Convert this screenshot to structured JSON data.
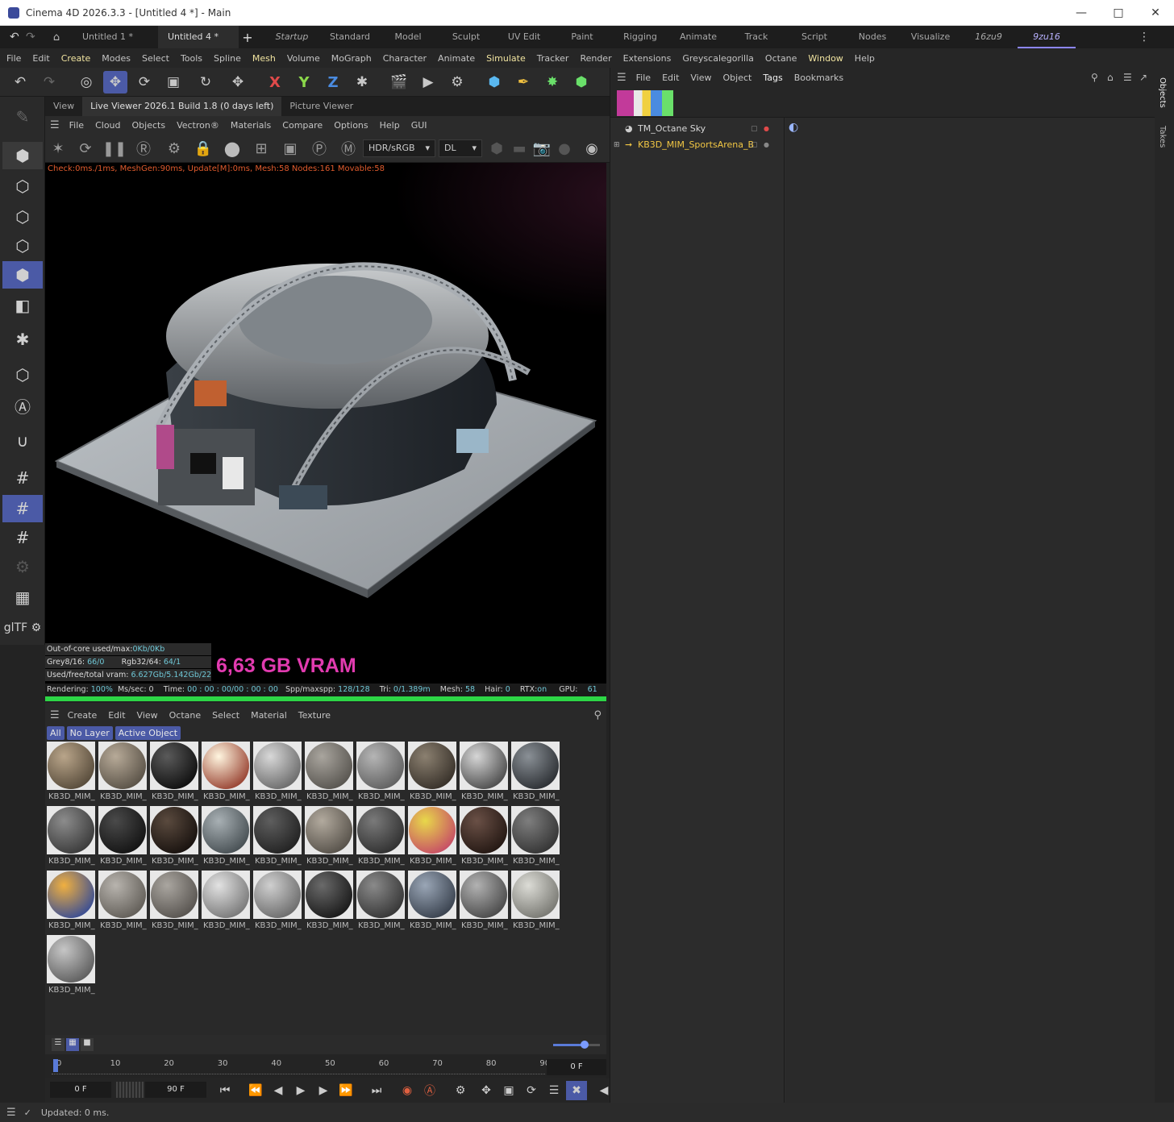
{
  "window": {
    "title": "Cinema 4D 2026.3.3 - [Untitled 4 *] - Main"
  },
  "doc_tabs": [
    {
      "label": "Untitled 1 *"
    },
    {
      "label": "Untitled 4 *"
    }
  ],
  "layouts": [
    "Startup",
    "Standard",
    "Model",
    "Sculpt",
    "UV Edit",
    "Paint",
    "Rigging",
    "Animate",
    "Track",
    "Script",
    "Nodes",
    "Visualize",
    "16zu9",
    "9zu16"
  ],
  "menubar": [
    "File",
    "Edit",
    "Create",
    "Modes",
    "Select",
    "Tools",
    "Spline",
    "Mesh",
    "Volume",
    "MoGraph",
    "Character",
    "Animate",
    "Simulate",
    "Tracker",
    "Render",
    "Extensions",
    "Greyscalegorilla",
    "Octane",
    "Window",
    "Help"
  ],
  "toolbar": {
    "axis": [
      "X",
      "Y",
      "Z"
    ],
    "colors": {
      "x": "#e04a4a",
      "y": "#8bd84a",
      "z": "#4a8be0",
      "accent": "#4b5aa6"
    }
  },
  "left_tools": {
    "gltf_label": "glTF"
  },
  "viewer_tabs": [
    "View",
    "Live Viewer 2026.1 Build 1.8 (0 days left)",
    "Picture Viewer"
  ],
  "lv_menu": [
    "File",
    "Cloud",
    "Objects",
    "Vectron®",
    "Materials",
    "Compare",
    "Options",
    "Help",
    "GUI"
  ],
  "lv_tools": {
    "colorspace": "HDR/sRGB",
    "kernel": "DL"
  },
  "viewport": {
    "stats_line": "Check:0ms./1ms, MeshGen:90ms, Update[M]:0ms, Mesh:58 Nodes:161 Movable:58",
    "vram_text": "6,63 GB VRAM",
    "info": {
      "outofcore_label": "Out-of-core used/max:",
      "outofcore_val": "0Kb/0Kb",
      "grey_label": "Grey8/16: ",
      "grey_val": "66/0",
      "rgb_label": "Rgb32/64: ",
      "rgb_val": "64/1",
      "vram_label": "Used/free/total vram: ",
      "vram_val": "6.627Gb/5.142Gb/22.488"
    }
  },
  "render_status": {
    "rendering_label": "Rendering: ",
    "rendering_val": "100%",
    "mssec": "Ms/sec: 0",
    "time_label": "Time: ",
    "time_val": "00 : 00 : 00/00 : 00 : 00",
    "spp_label": "Spp/maxspp: ",
    "spp_val": "128/128",
    "tri_label": "Tri: ",
    "tri_val": "0/1.389m",
    "mesh_label": "Mesh: ",
    "mesh_val": "58",
    "hair_label": "Hair: ",
    "hair_val": "0",
    "rtx_label": "RTX:",
    "rtx_val": "on",
    "gpu_label": "GPU:",
    "gpu_val": "61",
    "progress": 1.0
  },
  "mat_menu": [
    "Create",
    "Edit",
    "View",
    "Octane",
    "Select",
    "Material",
    "Texture"
  ],
  "mat_filters": [
    "All",
    "No Layer",
    "Active Object"
  ],
  "materials": [
    {
      "label": "KB3D_MIM_",
      "c1": "#b9a58a",
      "c2": "#4a3f30"
    },
    {
      "label": "KB3D_MIM_",
      "c1": "#b7aa98",
      "c2": "#4d463c"
    },
    {
      "label": "KB3D_MIM_",
      "c1": "#5a5a5a",
      "c2": "#050505"
    },
    {
      "label": "KB3D_MIM_",
      "c1": "#fff6e0",
      "c2": "#8a2a1a"
    },
    {
      "label": "KB3D_MIM_",
      "c1": "#d8d8d8",
      "c2": "#5c5c5c"
    },
    {
      "label": "KB3D_MIM_",
      "c1": "#a9a59e",
      "c2": "#4d4a45"
    },
    {
      "label": "KB3D_MIM_",
      "c1": "#b5b5b5",
      "c2": "#555555"
    },
    {
      "label": "KB3D_MIM_",
      "c1": "#8b8070",
      "c2": "#2c2620"
    },
    {
      "label": "KB3D_MIM_",
      "c1": "#d6d6d6",
      "c2": "#3a3a3a"
    },
    {
      "label": "KB3D_MIM_",
      "c1": "#8a9096",
      "c2": "#1f2226"
    },
    {
      "label": "KB3D_MIM_",
      "c1": "#8c8c8c",
      "c2": "#2f2f2f"
    },
    {
      "label": "KB3D_MIM_",
      "c1": "#4a4a4a",
      "c2": "#0c0c0c"
    },
    {
      "label": "KB3D_MIM_",
      "c1": "#5a4a3e",
      "c2": "#0f0a08"
    },
    {
      "label": "KB3D_MIM_",
      "c1": "#a8b0b4",
      "c2": "#3a4246"
    },
    {
      "label": "KB3D_MIM_",
      "c1": "#5e5e5e",
      "c2": "#1a1a1a"
    },
    {
      "label": "KB3D_MIM_",
      "c1": "#b2aa9e",
      "c2": "#4a453e"
    },
    {
      "label": "KB3D_MIM_",
      "c1": "#7a7a7a",
      "c2": "#262626"
    },
    {
      "label": "KB3D_MIM_",
      "c1": "#e8d84a",
      "c2": "#c23a6a"
    },
    {
      "label": "KB3D_MIM_",
      "c1": "#6a5046",
      "c2": "#1a100c"
    },
    {
      "label": "KB3D_MIM_",
      "c1": "#7e7e7e",
      "c2": "#2a2a2a"
    },
    {
      "label": "KB3D_MIM_",
      "c1": "#f0b040",
      "c2": "#2040a0"
    },
    {
      "label": "KB3D_MIM_",
      "c1": "#b8b4ae",
      "c2": "#56524c"
    },
    {
      "label": "KB3D_MIM_",
      "c1": "#aaa6a0",
      "c2": "#4c4844"
    },
    {
      "label": "KB3D_MIM_",
      "c1": "#e2e2e2",
      "c2": "#6a6a6a"
    },
    {
      "label": "KB3D_MIM_",
      "c1": "#cfcfcf",
      "c2": "#5e5e5e"
    },
    {
      "label": "KB3D_MIM_",
      "c1": "#6a6a6a",
      "c2": "#0e0e0e"
    },
    {
      "label": "KB3D_MIM_",
      "c1": "#8a8a8a",
      "c2": "#2a2a2a"
    },
    {
      "label": "KB3D_MIM_",
      "c1": "#9aa6b6",
      "c2": "#2c3440"
    },
    {
      "label": "KB3D_MIM_",
      "c1": "#b2b2b2",
      "c2": "#3c3c3c"
    },
    {
      "label": "KB3D_MIM_",
      "c1": "#dcdcd6",
      "c2": "#6a6a64"
    },
    {
      "label": "KB3D_MIM_",
      "c1": "#c6c6c6",
      "c2": "#505050"
    }
  ],
  "timeline": {
    "ticks": [
      "0",
      "10",
      "20",
      "30",
      "40",
      "50",
      "60",
      "70",
      "80",
      "90"
    ],
    "current_frame": "0 F"
  },
  "playback": {
    "start": "0 F",
    "end": "90 F"
  },
  "status": {
    "text": "Updated: 0 ms."
  },
  "objects": {
    "menu": [
      "File",
      "Edit",
      "View",
      "Object",
      "Tags",
      "Bookmarks"
    ],
    "items": [
      {
        "name": "TM_Octane Sky",
        "color": "#d8d8d8"
      },
      {
        "name": "KB3D_MIM_SportsArena_B",
        "color": "#f2c744"
      }
    ]
  },
  "right_tabs": [
    "Objects",
    "Takes"
  ]
}
